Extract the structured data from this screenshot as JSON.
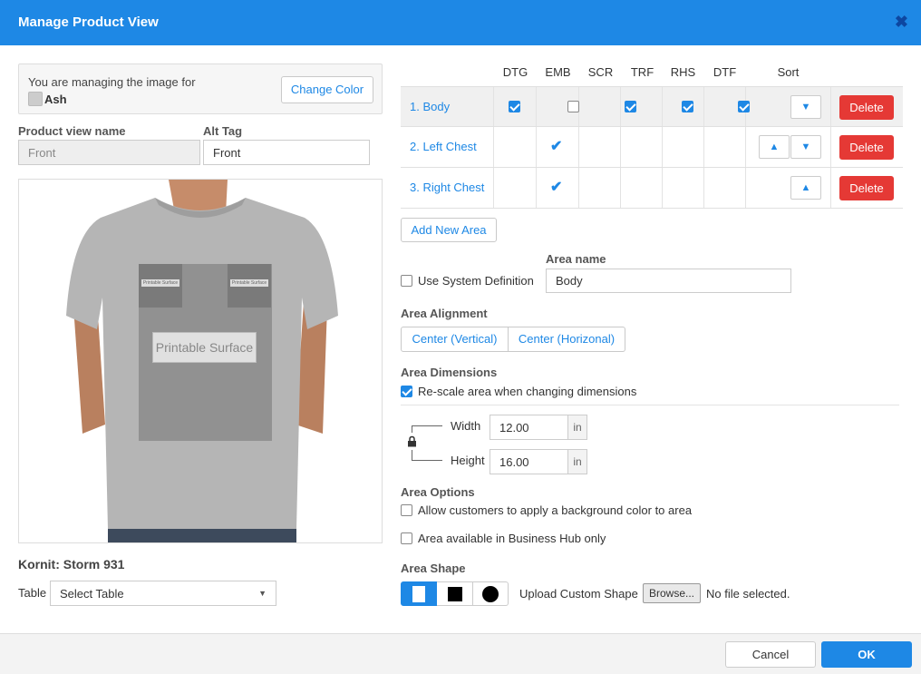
{
  "window": {
    "title": "Manage Product View"
  },
  "image_panel": {
    "managing_text": "You are managing the image for",
    "color_name": "Ash",
    "change_color_label": "Change Color"
  },
  "view": {
    "name_label": "Product view name",
    "name_value": "Front",
    "alt_label": "Alt Tag",
    "alt_value": "Front"
  },
  "preview": {
    "big_area_label": "Printable Surface",
    "small_left_label": "Printable Surface",
    "small_right_label": "Printable Surface"
  },
  "machine": {
    "name": "Kornit: Storm 931",
    "table_label": "Table",
    "table_value": "Select Table"
  },
  "areas": {
    "headers": [
      "DTG",
      "EMB",
      "SCR",
      "TRF",
      "RHS",
      "DTF",
      "Sort"
    ],
    "rows": [
      {
        "name": "1. Body",
        "DTG": true,
        "EMB": false,
        "SCR": true,
        "TRF": true,
        "RHS": true,
        "DTF": true,
        "delete": "Delete"
      },
      {
        "name": "2. Left Chest",
        "EMB": true,
        "delete": "Delete"
      },
      {
        "name": "3. Right Chest",
        "EMB": true,
        "delete": "Delete"
      }
    ],
    "add_label": "Add New Area"
  },
  "area_form": {
    "use_system_label": "Use System Definition",
    "name_label": "Area name",
    "name_value": "Body",
    "alignment_label": "Area Alignment",
    "align_vertical": "Center (Vertical)",
    "align_horizontal": "Center (Horizonal)",
    "dimensions_label": "Area Dimensions",
    "rescale_label": "Re-scale area when changing dimensions",
    "width_label": "Width",
    "width_value": "12.00",
    "height_label": "Height",
    "height_value": "16.00",
    "unit": "in",
    "options_label": "Area Options",
    "bg_color_label": "Allow customers to apply a background color to area",
    "business_hub_label": "Area available in Business Hub only",
    "shape_label": "Area Shape",
    "upload_label": "Upload Custom Shape",
    "browse_label": "Browse...",
    "no_file_label": "No file selected."
  },
  "footer": {
    "cancel": "Cancel",
    "ok": "OK"
  }
}
